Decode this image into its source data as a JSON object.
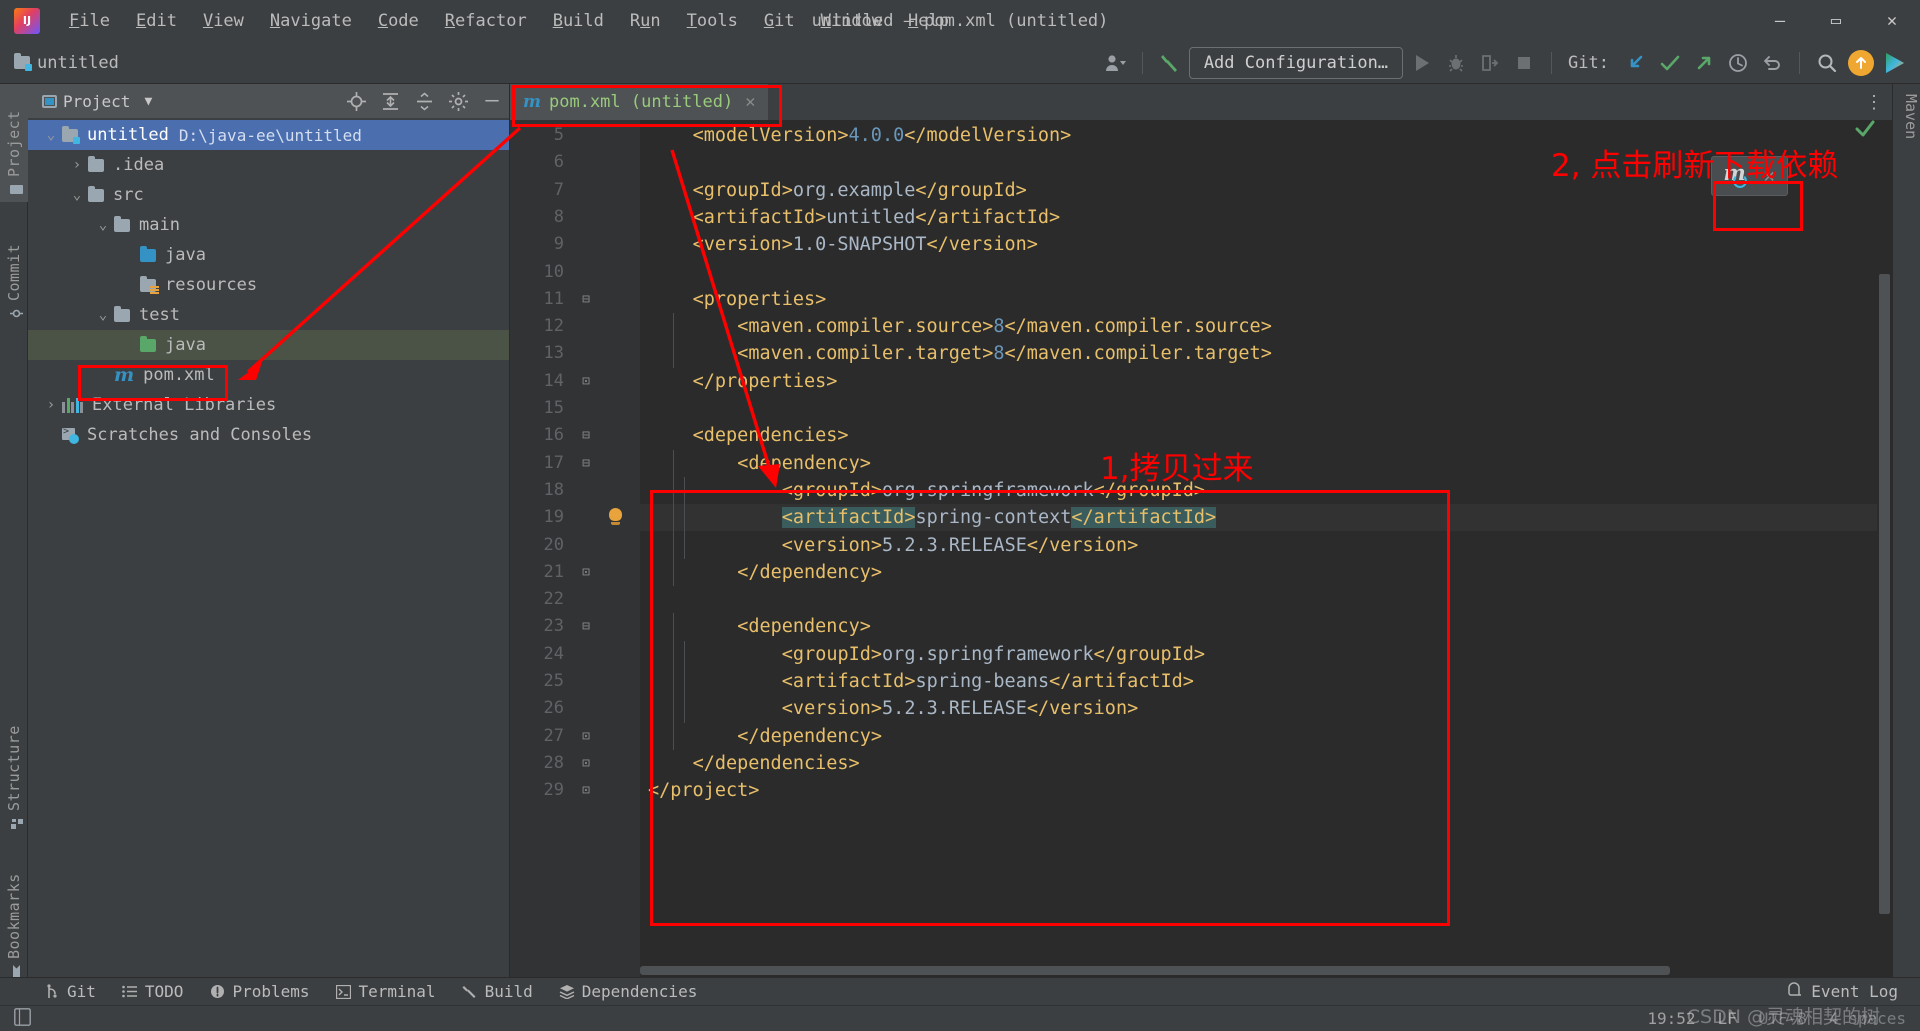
{
  "window": {
    "title": "untitled – pom.xml (untitled)",
    "minimize": "—",
    "maximize": "▭",
    "close": "✕"
  },
  "menu": {
    "items": [
      {
        "pre": "",
        "mn": "F",
        "post": "ile"
      },
      {
        "pre": "",
        "mn": "E",
        "post": "dit"
      },
      {
        "pre": "",
        "mn": "V",
        "post": "iew"
      },
      {
        "pre": "",
        "mn": "N",
        "post": "avigate"
      },
      {
        "pre": "",
        "mn": "C",
        "post": "ode"
      },
      {
        "pre": "",
        "mn": "R",
        "post": "efactor"
      },
      {
        "pre": "",
        "mn": "B",
        "post": "uild"
      },
      {
        "pre": "R",
        "mn": "u",
        "post": "n"
      },
      {
        "pre": "",
        "mn": "T",
        "post": "ools"
      },
      {
        "pre": "",
        "mn": "G",
        "post": "it"
      },
      {
        "pre": "",
        "mn": "W",
        "post": "indow"
      },
      {
        "pre": "",
        "mn": "H",
        "post": "elp"
      }
    ]
  },
  "toolbar": {
    "project_crumb": "untitled",
    "add_configuration": "Add Configuration…",
    "git_label": "Git:"
  },
  "left_strip": {
    "tabs": [
      {
        "label": "Project",
        "icon": "project-icon",
        "selected": true
      },
      {
        "label": "Commit",
        "icon": "commit-icon",
        "selected": false
      },
      {
        "label": "Structure",
        "icon": "structure-icon",
        "selected": false
      },
      {
        "label": "Bookmarks",
        "icon": "bookmark-icon",
        "selected": false
      }
    ]
  },
  "right_strip": {
    "tabs": [
      {
        "label": "Maven",
        "icon": "maven-icon"
      }
    ]
  },
  "project_panel": {
    "title": "Project",
    "dropdown_icon": "chevron-down-icon",
    "actions": [
      "locate-icon",
      "expand-all-icon",
      "collapse-all-icon",
      "gear-icon",
      "hide-icon"
    ],
    "tree": [
      {
        "indent": 0,
        "chevron": "⌄",
        "icon": "module-folder-icon",
        "label": "untitled",
        "path": "D:\\java-ee\\untitled",
        "state": "selected"
      },
      {
        "indent": 1,
        "chevron": "›",
        "icon": "folder-icon",
        "label": ".idea",
        "path": "",
        "state": "normal"
      },
      {
        "indent": 1,
        "chevron": "⌄",
        "icon": "folder-icon",
        "label": "src",
        "path": "",
        "state": "normal"
      },
      {
        "indent": 2,
        "chevron": "⌄",
        "icon": "folder-icon",
        "label": "main",
        "path": "",
        "state": "normal"
      },
      {
        "indent": 3,
        "chevron": "",
        "icon": "source-folder-icon",
        "label": "java",
        "path": "",
        "state": "normal"
      },
      {
        "indent": 3,
        "chevron": "",
        "icon": "resource-folder-icon",
        "label": "resources",
        "path": "",
        "state": "normal"
      },
      {
        "indent": 2,
        "chevron": "⌄",
        "icon": "folder-icon",
        "label": "test",
        "path": "",
        "state": "normal"
      },
      {
        "indent": 3,
        "chevron": "",
        "icon": "test-source-folder-icon",
        "label": "java",
        "path": "",
        "state": "green"
      },
      {
        "indent": 2,
        "chevron": "",
        "icon": "maven-file-icon",
        "label": "pom.xml",
        "path": "",
        "state": "normal"
      },
      {
        "indent": 0,
        "chevron": "›",
        "icon": "external-libraries-icon",
        "label": "External Libraries",
        "path": "",
        "state": "normal"
      },
      {
        "indent": 0,
        "chevron": "",
        "icon": "scratches-icon",
        "label": "Scratches and Consoles",
        "path": "",
        "state": "normal"
      }
    ]
  },
  "editor": {
    "tab": {
      "label": "pom.xml (untitled)",
      "icon": "maven-file-icon",
      "close": "✕"
    },
    "kebab": "⋮",
    "lines": [
      {
        "num": "5",
        "indent": 1,
        "segs": [
          {
            "t": "<modelVersion>",
            "c": "tag"
          },
          {
            "t": "4.0.0",
            "c": "num"
          },
          {
            "t": "</modelVersion>",
            "c": "tag"
          }
        ]
      },
      {
        "num": "6",
        "indent": 0,
        "segs": []
      },
      {
        "num": "7",
        "indent": 1,
        "segs": [
          {
            "t": "<groupId>",
            "c": "tag"
          },
          {
            "t": "org.example",
            "c": "txt"
          },
          {
            "t": "</groupId>",
            "c": "tag"
          }
        ]
      },
      {
        "num": "8",
        "indent": 1,
        "segs": [
          {
            "t": "<artifactId>",
            "c": "tag"
          },
          {
            "t": "untitled",
            "c": "txt"
          },
          {
            "t": "</artifactId>",
            "c": "tag"
          }
        ]
      },
      {
        "num": "9",
        "indent": 1,
        "segs": [
          {
            "t": "<version>",
            "c": "tag"
          },
          {
            "t": "1.0-SNAPSHOT",
            "c": "txt"
          },
          {
            "t": "</version>",
            "c": "tag"
          }
        ]
      },
      {
        "num": "10",
        "indent": 0,
        "segs": []
      },
      {
        "num": "11",
        "indent": 1,
        "segs": [
          {
            "t": "<properties>",
            "c": "tag"
          }
        ],
        "fold": "⊟"
      },
      {
        "num": "12",
        "indent": 2,
        "segs": [
          {
            "t": "<maven.compiler.source>",
            "c": "tag"
          },
          {
            "t": "8",
            "c": "num"
          },
          {
            "t": "</maven.compiler.source>",
            "c": "tag"
          }
        ]
      },
      {
        "num": "13",
        "indent": 2,
        "segs": [
          {
            "t": "<maven.compiler.target>",
            "c": "tag"
          },
          {
            "t": "8",
            "c": "num"
          },
          {
            "t": "</maven.compiler.target>",
            "c": "tag"
          }
        ]
      },
      {
        "num": "14",
        "indent": 1,
        "segs": [
          {
            "t": "</properties>",
            "c": "tag"
          }
        ],
        "fold": "⊡"
      },
      {
        "num": "15",
        "indent": 0,
        "segs": []
      },
      {
        "num": "16",
        "indent": 1,
        "segs": [
          {
            "t": "<dependencies>",
            "c": "tag"
          }
        ],
        "fold": "⊟"
      },
      {
        "num": "17",
        "indent": 2,
        "segs": [
          {
            "t": "<dependency>",
            "c": "tag"
          }
        ],
        "fold": "⊟"
      },
      {
        "num": "18",
        "indent": 3,
        "segs": [
          {
            "t": "<groupId>",
            "c": "tag"
          },
          {
            "t": "org.springframework",
            "c": "txt"
          },
          {
            "t": "</groupId>",
            "c": "tag"
          }
        ]
      },
      {
        "num": "19",
        "indent": 3,
        "bulb": true,
        "highlight": true,
        "segs": [
          {
            "t": "<artifactId>",
            "c": "tag",
            "hl": true
          },
          {
            "t": "spring-context",
            "c": "txt"
          },
          {
            "t": "</artifactId>",
            "c": "tag",
            "hl": true
          }
        ]
      },
      {
        "num": "20",
        "indent": 3,
        "segs": [
          {
            "t": "<version>",
            "c": "tag"
          },
          {
            "t": "5.2.3.RELEASE",
            "c": "txt"
          },
          {
            "t": "</version>",
            "c": "tag"
          }
        ]
      },
      {
        "num": "21",
        "indent": 2,
        "segs": [
          {
            "t": "</dependency>",
            "c": "tag"
          }
        ],
        "fold": "⊡"
      },
      {
        "num": "22",
        "indent": 0,
        "segs": []
      },
      {
        "num": "23",
        "indent": 2,
        "segs": [
          {
            "t": "<dependency>",
            "c": "tag"
          }
        ],
        "fold": "⊟"
      },
      {
        "num": "24",
        "indent": 3,
        "segs": [
          {
            "t": "<groupId>",
            "c": "tag"
          },
          {
            "t": "org.springframework",
            "c": "txt"
          },
          {
            "t": "</groupId>",
            "c": "tag"
          }
        ]
      },
      {
        "num": "25",
        "indent": 3,
        "segs": [
          {
            "t": "<artifactId>",
            "c": "tag"
          },
          {
            "t": "spring-beans",
            "c": "txt"
          },
          {
            "t": "</artifactId>",
            "c": "tag"
          }
        ]
      },
      {
        "num": "26",
        "indent": 3,
        "segs": [
          {
            "t": "<version>",
            "c": "tag"
          },
          {
            "t": "5.2.3.RELEASE",
            "c": "txt"
          },
          {
            "t": "</version>",
            "c": "tag"
          }
        ]
      },
      {
        "num": "27",
        "indent": 2,
        "segs": [
          {
            "t": "</dependency>",
            "c": "tag"
          }
        ],
        "fold": "⊡"
      },
      {
        "num": "28",
        "indent": 1,
        "segs": [
          {
            "t": "</dependencies>",
            "c": "tag"
          }
        ],
        "fold": "⊡"
      },
      {
        "num": "29",
        "indent": 0,
        "segs": [
          {
            "t": "</project>",
            "c": "tag"
          }
        ],
        "fold": "⊡"
      }
    ]
  },
  "maven_popup": {
    "reload_icon": "maven-reload-icon",
    "close": "✕"
  },
  "annotations": [
    {
      "id": "step1",
      "text": "1,拷贝过来"
    },
    {
      "id": "step2",
      "text": "2, 点击刷新下载依赖"
    }
  ],
  "bottom_tools": {
    "items": [
      {
        "label": "Git",
        "icon": "git-branch-icon"
      },
      {
        "label": "TODO",
        "icon": "todo-list-icon"
      },
      {
        "label": "Problems",
        "icon": "problems-icon"
      },
      {
        "label": "Terminal",
        "icon": "terminal-icon"
      },
      {
        "label": "Build",
        "icon": "build-hammer-icon"
      },
      {
        "label": "Dependencies",
        "icon": "dependencies-icon"
      }
    ],
    "event_log": "Event Log",
    "event_log_icon": "event-log-icon"
  },
  "status_bar": {
    "left_icon": "toggle-sidebar-icon",
    "caret": "19:52",
    "line_sep": "LF",
    "encoding": "UTF-8",
    "indent": "4 spaces"
  },
  "watermark": "CSDN @灵魂相契的树",
  "colors": {
    "annotation_red": "#ff0000",
    "accent_blue": "#3592c4",
    "tag_yellow": "#e8bf6a",
    "text_grey": "#a9b7c6",
    "number_blue": "#6897bb",
    "selection_blue": "#4b6eaf",
    "editor_bg": "#2b2b2b",
    "panel_bg": "#3c3f41"
  }
}
